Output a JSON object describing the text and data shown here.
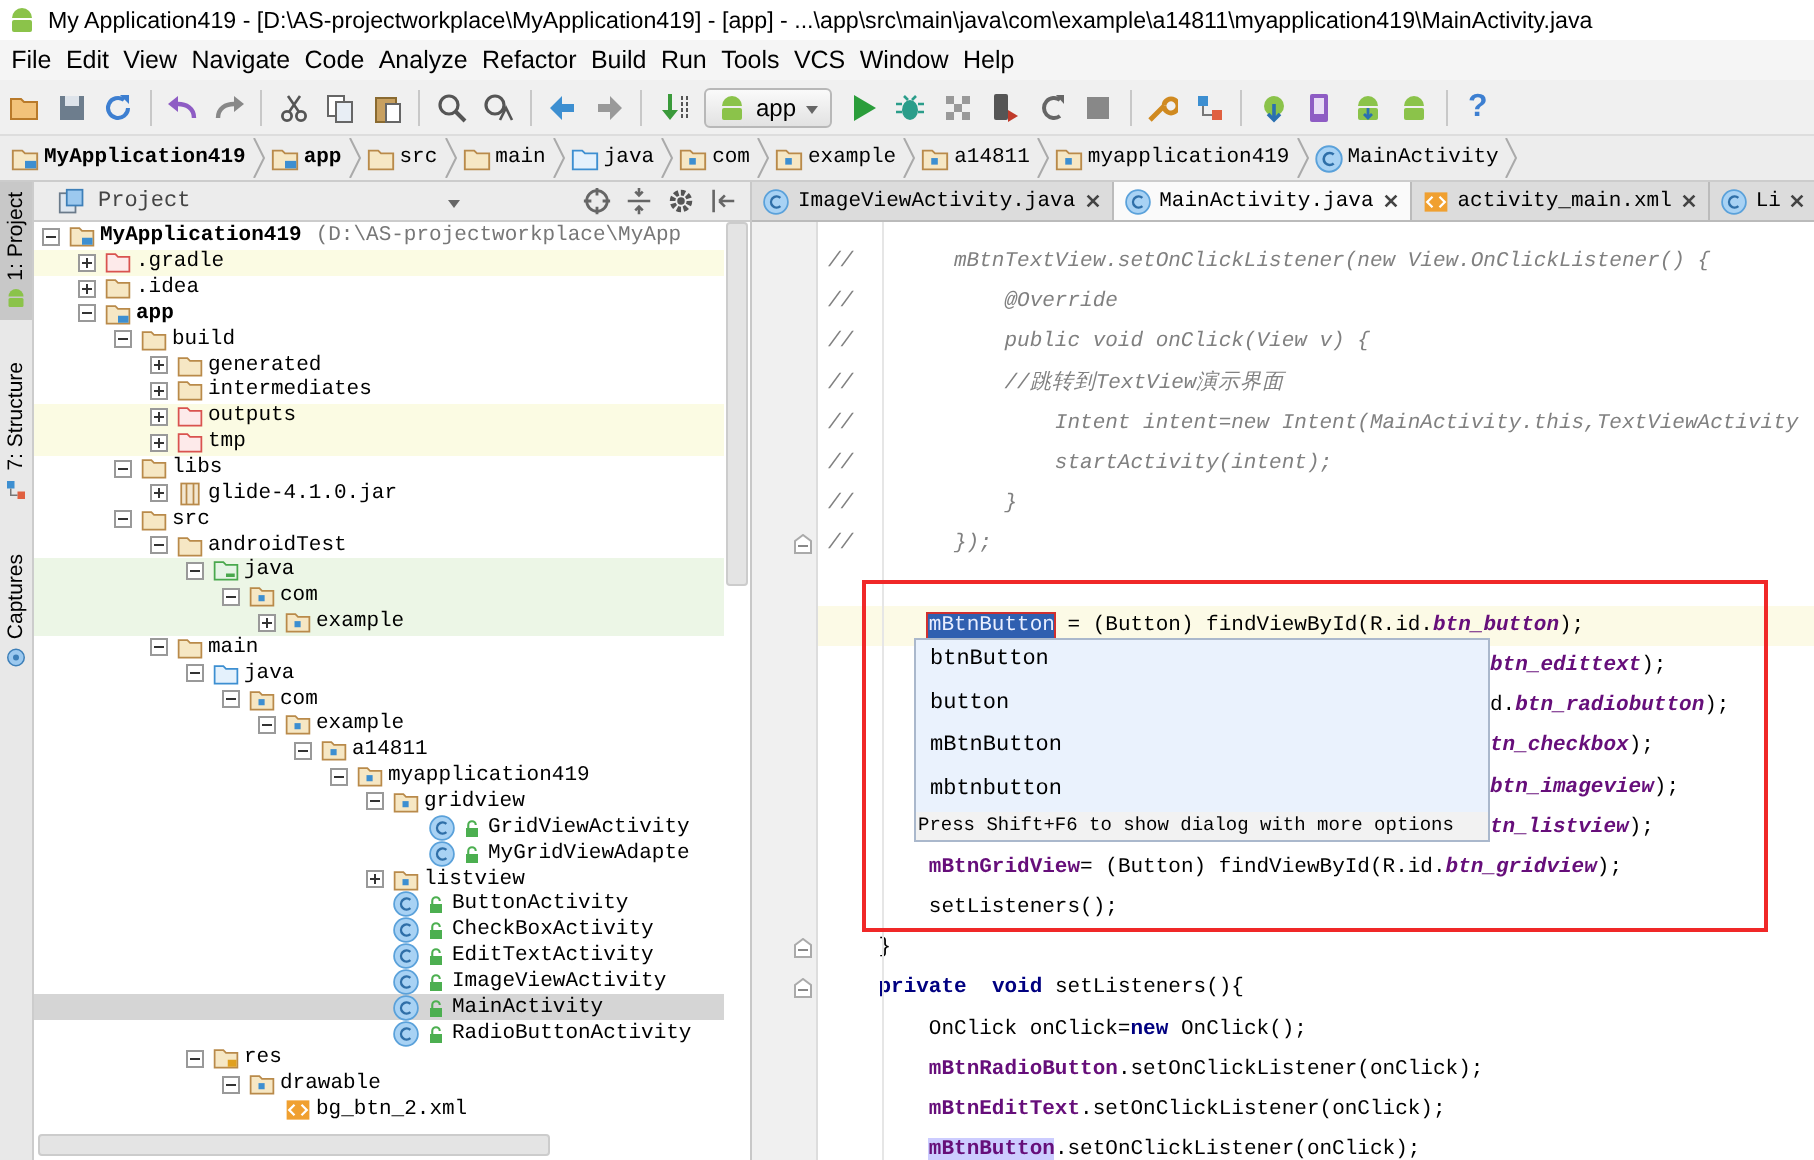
{
  "window": {
    "title": "My Application419 - [D:\\AS-projectworkplace\\MyApplication419] - [app] - ...\\app\\src\\main\\java\\com\\example\\a14811\\myapplication419\\MainActivity.java"
  },
  "menu": [
    "File",
    "Edit",
    "View",
    "Navigate",
    "Code",
    "Analyze",
    "Refactor",
    "Build",
    "Run",
    "Tools",
    "VCS",
    "Window",
    "Help"
  ],
  "toolbar": [
    {
      "kind": "open"
    },
    {
      "kind": "save"
    },
    {
      "kind": "sync"
    },
    {
      "kind": "separator"
    },
    {
      "kind": "undo"
    },
    {
      "kind": "redo"
    },
    {
      "kind": "separator"
    },
    {
      "kind": "cut"
    },
    {
      "kind": "copy"
    },
    {
      "kind": "paste"
    },
    {
      "kind": "separator"
    },
    {
      "kind": "find"
    },
    {
      "kind": "replace"
    },
    {
      "kind": "separator"
    },
    {
      "kind": "back"
    },
    {
      "kind": "forward"
    },
    {
      "kind": "separator"
    },
    {
      "kind": "make"
    },
    {
      "kind": "run-config",
      "label": "app"
    },
    {
      "kind": "run"
    },
    {
      "kind": "debug"
    },
    {
      "kind": "attach"
    },
    {
      "kind": "apply"
    },
    {
      "kind": "rerun"
    },
    {
      "kind": "stop"
    },
    {
      "kind": "separator"
    },
    {
      "kind": "sdk-tools"
    },
    {
      "kind": "structure"
    },
    {
      "kind": "separator"
    },
    {
      "kind": "avd"
    },
    {
      "kind": "device"
    },
    {
      "kind": "download"
    },
    {
      "kind": "android"
    },
    {
      "kind": "separator"
    },
    {
      "kind": "help",
      "label": "?"
    }
  ],
  "breadcrumbs": [
    {
      "label": "MyApplication419",
      "kind": "module"
    },
    {
      "label": "app",
      "kind": "module"
    },
    {
      "label": "src",
      "kind": "folder"
    },
    {
      "label": "main",
      "kind": "folder"
    },
    {
      "label": "java",
      "kind": "source-folder"
    },
    {
      "label": "com",
      "kind": "package"
    },
    {
      "label": "example",
      "kind": "package"
    },
    {
      "label": "a14811",
      "kind": "package"
    },
    {
      "label": "myapplication419",
      "kind": "package"
    },
    {
      "label": "MainActivity",
      "kind": "class"
    }
  ],
  "side_tabs": [
    {
      "label": "1: Project",
      "kind": "project",
      "selected": true
    },
    {
      "label": "7: Structure",
      "kind": "structure",
      "selected": false
    },
    {
      "label": "Captures",
      "kind": "captures",
      "selected": false
    }
  ],
  "project_panel": {
    "view": "Project",
    "tree": [
      {
        "name": "MyApplication419",
        "path": "(D:\\AS-projectworkplace\\MyApp",
        "kind": "module",
        "expanded": true,
        "selected": false,
        "children": [
          {
            "name": ".gradle",
            "kind": "excluded-folder",
            "expanded": false,
            "selected": false
          },
          {
            "name": ".idea",
            "kind": "folder",
            "expanded": false,
            "selected": false
          },
          {
            "name": "app",
            "kind": "module",
            "expanded": true,
            "selected": false,
            "children": [
              {
                "name": "build",
                "kind": "folder",
                "expanded": true,
                "selected": false,
                "children": [
                  {
                    "name": "generated",
                    "kind": "folder",
                    "expanded": false,
                    "selected": false
                  },
                  {
                    "name": "intermediates",
                    "kind": "folder",
                    "expanded": false,
                    "selected": false
                  },
                  {
                    "name": "outputs",
                    "kind": "excluded-folder",
                    "expanded": false,
                    "selected": false
                  },
                  {
                    "name": "tmp",
                    "kind": "excluded-folder",
                    "expanded": false,
                    "selected": false
                  }
                ]
              },
              {
                "name": "libs",
                "kind": "folder",
                "expanded": true,
                "selected": false,
                "children": [
                  {
                    "name": "glide-4.1.0.jar",
                    "kind": "jar",
                    "expanded": false,
                    "selected": false
                  }
                ]
              },
              {
                "name": "src",
                "kind": "folder",
                "expanded": true,
                "selected": false,
                "children": [
                  {
                    "name": "androidTest",
                    "kind": "folder",
                    "expanded": true,
                    "selected": false,
                    "children": [
                      {
                        "name": "java",
                        "kind": "test-folder",
                        "expanded": true,
                        "selected": false,
                        "children": [
                          {
                            "name": "com",
                            "kind": "test-package",
                            "expanded": true,
                            "selected": false,
                            "children": [
                              {
                                "name": "example",
                                "kind": "test-package",
                                "expanded": false,
                                "selected": false
                              }
                            ]
                          }
                        ]
                      }
                    ]
                  },
                  {
                    "name": "main",
                    "kind": "folder",
                    "expanded": true,
                    "selected": false,
                    "children": [
                      {
                        "name": "java",
                        "kind": "source-folder",
                        "expanded": true,
                        "selected": false,
                        "children": [
                          {
                            "name": "com",
                            "kind": "package",
                            "expanded": true,
                            "selected": false,
                            "children": [
                              {
                                "name": "example",
                                "kind": "package",
                                "expanded": true,
                                "selected": false,
                                "children": [
                                  {
                                    "name": "a14811",
                                    "kind": "package",
                                    "expanded": true,
                                    "selected": false,
                                    "children": [
                                      {
                                        "name": "myapplication419",
                                        "kind": "package",
                                        "expanded": true,
                                        "selected": false,
                                        "children": [
                                          {
                                            "name": "gridview",
                                            "kind": "package",
                                            "expanded": true,
                                            "selected": false,
                                            "children": [
                                              {
                                                "name": "GridViewActivity",
                                                "kind": "class",
                                                "selected": false
                                              },
                                              {
                                                "name": "MyGridViewAdapte",
                                                "kind": "class",
                                                "selected": false
                                              }
                                            ]
                                          },
                                          {
                                            "name": "listview",
                                            "kind": "package",
                                            "expanded": false,
                                            "selected": false
                                          },
                                          {
                                            "name": "ButtonActivity",
                                            "kind": "class",
                                            "selected": false
                                          },
                                          {
                                            "name": "CheckBoxActivity",
                                            "kind": "class",
                                            "selected": false
                                          },
                                          {
                                            "name": "EditTextActivity",
                                            "kind": "class",
                                            "selected": false
                                          },
                                          {
                                            "name": "ImageViewActivity",
                                            "kind": "class",
                                            "selected": false
                                          },
                                          {
                                            "name": "MainActivity",
                                            "kind": "class",
                                            "selected": true
                                          },
                                          {
                                            "name": "RadioButtonActivity",
                                            "kind": "class",
                                            "selected": false
                                          }
                                        ]
                                      }
                                    ]
                                  }
                                ]
                              }
                            ]
                          }
                        ]
                      },
                      {
                        "name": "res",
                        "kind": "res-folder",
                        "expanded": true,
                        "selected": false,
                        "children": [
                          {
                            "name": "drawable",
                            "kind": "package",
                            "expanded": true,
                            "selected": false,
                            "children": [
                              {
                                "name": "bg_btn_2.xml",
                                "kind": "xml",
                                "selected": false
                              }
                            ]
                          }
                        ]
                      }
                    ]
                  }
                ]
              }
            ]
          }
        ]
      }
    ]
  },
  "editor_tabs": [
    {
      "label": "ImageViewActivity.java",
      "kind": "class",
      "selected": false
    },
    {
      "label": "MainActivity.java",
      "kind": "class",
      "selected": true
    },
    {
      "label": "activity_main.xml",
      "kind": "xml",
      "selected": false
    },
    {
      "label": "Li",
      "kind": "class",
      "selected": false
    }
  ],
  "code_lines": [
    {
      "kind": "code",
      "fold": false,
      "segments": [
        {
          "text": "//        mBtnTextView.setOnClickListener(new View.OnClickListener() {",
          "kind": "comment"
        }
      ]
    },
    {
      "kind": "code",
      "fold": false,
      "segments": [
        {
          "text": "//            @Override",
          "kind": "comment"
        }
      ]
    },
    {
      "kind": "code",
      "fold": false,
      "segments": [
        {
          "text": "//            public void onClick(View v) {",
          "kind": "comment"
        }
      ]
    },
    {
      "kind": "code",
      "fold": false,
      "segments": [
        {
          "text": "//            //跳转到TextView演示界面",
          "kind": "comment"
        }
      ]
    },
    {
      "kind": "code",
      "fold": false,
      "segments": [
        {
          "text": "//                Intent intent=new Intent(MainActivity.this,TextViewActivity",
          "kind": "comment"
        }
      ]
    },
    {
      "kind": "code",
      "fold": false,
      "segments": [
        {
          "text": "//                startActivity(intent);",
          "kind": "comment"
        }
      ]
    },
    {
      "kind": "code",
      "fold": false,
      "segments": [
        {
          "text": "//            }",
          "kind": "comment"
        }
      ]
    },
    {
      "kind": "code",
      "fold": true,
      "segments": [
        {
          "text": "//        });",
          "kind": "comment"
        }
      ]
    },
    {
      "kind": "blank"
    },
    {
      "kind": "current",
      "fold": false,
      "segments": [
        {
          "text": "        mBtnButton",
          "kind": "selection"
        },
        {
          "text": " = (Button) findViewById(R.id.",
          "kind": "plain"
        },
        {
          "text": "btn_button",
          "kind": "constant"
        },
        {
          "text": ");",
          "kind": "plain"
        }
      ]
    },
    {
      "kind": "covered",
      "fold": false,
      "segments": [
        {
          "text": "btn_edittext",
          "kind": "constant"
        },
        {
          "text": ");",
          "kind": "plain"
        }
      ]
    },
    {
      "kind": "covered",
      "fold": false,
      "segments": [
        {
          "text": "d.",
          "kind": "plain"
        },
        {
          "text": "btn_radiobutton",
          "kind": "constant"
        },
        {
          "text": ");",
          "kind": "plain"
        }
      ]
    },
    {
      "kind": "covered",
      "fold": false,
      "segments": [
        {
          "text": "tn_checkbox",
          "kind": "constant"
        },
        {
          "text": ");",
          "kind": "plain"
        }
      ]
    },
    {
      "kind": "covered",
      "fold": false,
      "segments": [
        {
          "text": "btn_imageview",
          "kind": "constant"
        },
        {
          "text": ");",
          "kind": "plain"
        }
      ]
    },
    {
      "kind": "covered",
      "fold": false,
      "segments": [
        {
          "text": "tn_listview",
          "kind": "constant"
        },
        {
          "text": ");",
          "kind": "plain"
        }
      ]
    },
    {
      "kind": "code",
      "fold": false,
      "segments": [
        {
          "text": "        mBtnGridView",
          "kind": "field"
        },
        {
          "text": "= (Button) findViewById(R.id.",
          "kind": "plain"
        },
        {
          "text": "btn_gridview",
          "kind": "constant"
        },
        {
          "text": ");",
          "kind": "plain"
        }
      ]
    },
    {
      "kind": "code",
      "fold": false,
      "segments": [
        {
          "text": "        setListeners();",
          "kind": "plain"
        }
      ]
    },
    {
      "kind": "code",
      "fold": true,
      "segments": [
        {
          "text": "    }",
          "kind": "plain"
        }
      ]
    },
    {
      "kind": "code",
      "fold": true,
      "segments": [
        {
          "text": "    private",
          "kind": "keyword"
        },
        {
          "text": "  void",
          "kind": "keyword"
        },
        {
          "text": " setListeners(){",
          "kind": "plain"
        }
      ]
    },
    {
      "kind": "code",
      "fold": false,
      "segments": [
        {
          "text": "        OnClick onClick=",
          "kind": "plain"
        },
        {
          "text": "new",
          "kind": "keyword"
        },
        {
          "text": " OnClick();",
          "kind": "plain"
        }
      ]
    },
    {
      "kind": "code",
      "fold": false,
      "segments": [
        {
          "text": "        mBtnRadioButton",
          "kind": "field"
        },
        {
          "text": ".setOnClickListener(onClick);",
          "kind": "plain"
        }
      ]
    },
    {
      "kind": "code",
      "fold": false,
      "segments": [
        {
          "text": "        mBtnEditText",
          "kind": "field"
        },
        {
          "text": ".setOnClickListener(onClick);",
          "kind": "plain"
        }
      ]
    },
    {
      "kind": "code",
      "fold": false,
      "segments": [
        {
          "text": "        mBtnButton",
          "kind": "usage"
        },
        {
          "text": ".setOnClickListener(onClick);",
          "kind": "plain"
        }
      ]
    }
  ],
  "rename_popup": {
    "items": [
      "btnButton",
      "button",
      "mBtnButton",
      "mbtnbutton"
    ],
    "hint": "Press Shift+F6 to show dialog with more options"
  }
}
